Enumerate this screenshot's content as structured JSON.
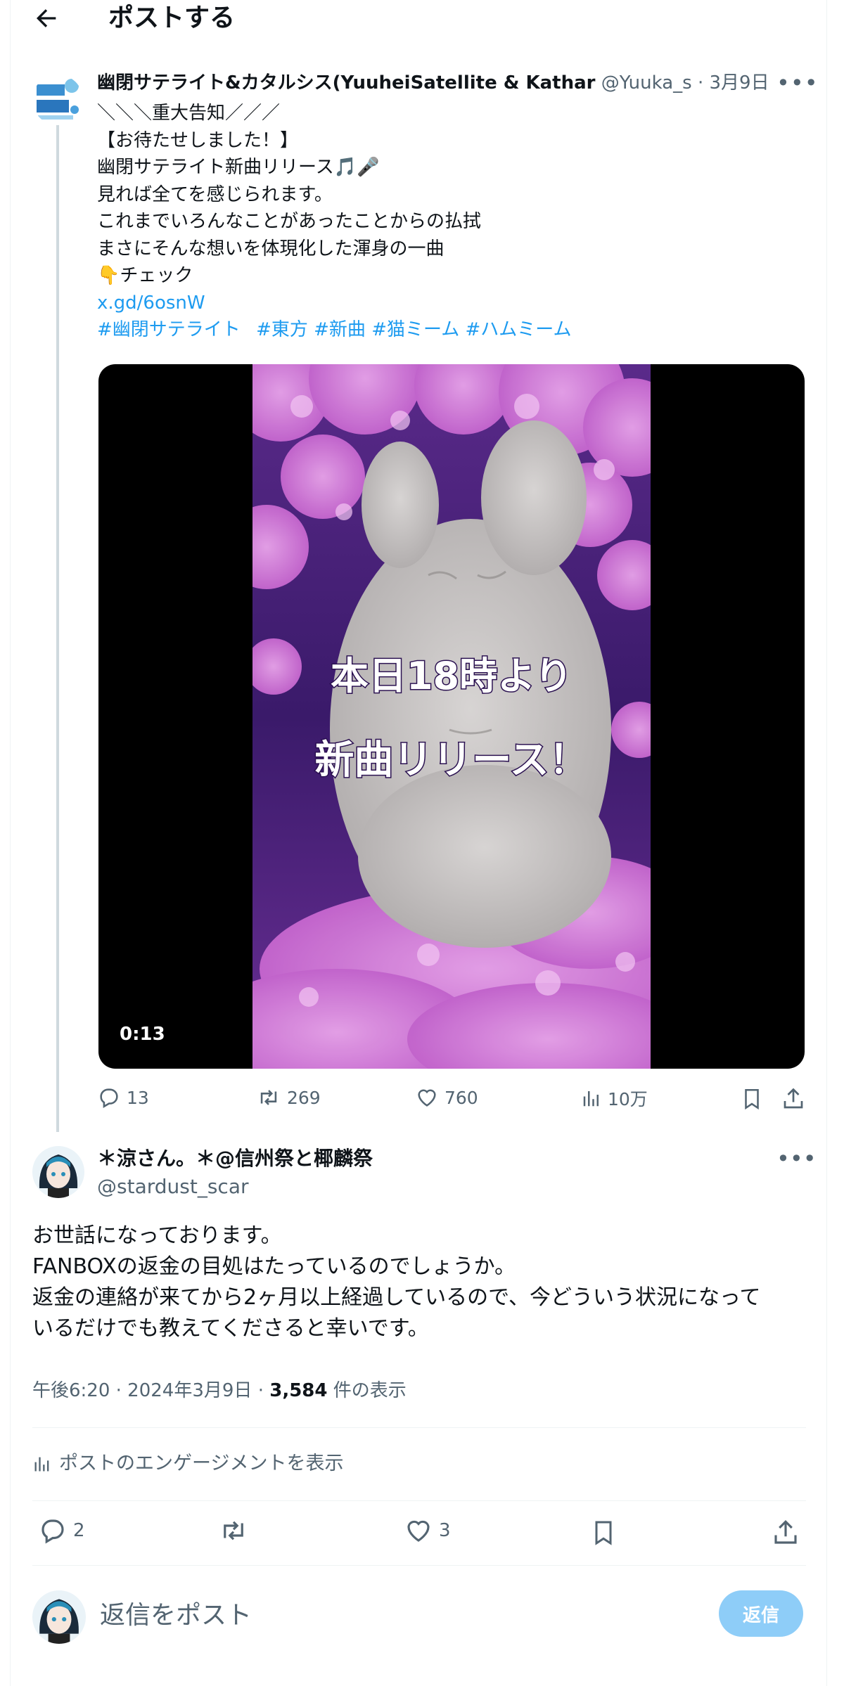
{
  "header": {
    "title": "ポストする"
  },
  "quoted_post": {
    "author_name": "幽閉サテライト&カタルシス(YuuheiSatellite & Kathar",
    "author_handle": "@Yuuka_s",
    "date": "· 3月9日",
    "lines": [
      "＼＼＼重大告知／／／",
      "【お待たせしました！】",
      "幽閉サテライト新曲リリース🎵🎤",
      "見れば全てを感じられます。",
      "これまでいろんなことがあったことからの払拭",
      "まさにそんな想いを体現化した渾身の一曲",
      "👇チェック"
    ],
    "link": "x.gd/6osnW",
    "hashtags": [
      "#幽閉サテライト",
      "#東方",
      "#新曲",
      "#猫ミーム",
      "#ハムミーム"
    ],
    "video": {
      "caption_line1": "本日18時より",
      "caption_line2": "新曲リリース！",
      "duration": "0:13"
    },
    "stats": {
      "replies": "13",
      "reposts": "269",
      "likes": "760",
      "views": "10万"
    }
  },
  "reply_post": {
    "author_name": "＊涼さん。＊@信州祭と椰麟祭",
    "author_handle": "@stardust_scar",
    "lines": [
      "お世話になっております。",
      "FANBOXの返金の目処はたっているのでしょうか。",
      "返金の連絡が来てから2ヶ月以上経過しているので、今どういう状況になって",
      "いるだけでも教えてくださると幸いです。"
    ],
    "time": "午後6:20 · 2024年3月9日 · ",
    "views_count": "3,584",
    "views_label": " 件の表示",
    "engagement_label": "ポストのエンゲージメントを表示",
    "stats": {
      "replies": "2",
      "likes": "3"
    }
  },
  "composer": {
    "placeholder": "返信をポスト",
    "button_label": "返信"
  },
  "icons": [
    "back-arrow-icon",
    "more-icon",
    "reply-icon",
    "repost-icon",
    "like-icon",
    "views-icon",
    "bookmark-icon",
    "share-icon",
    "analytics-icon"
  ],
  "colors": {
    "link": "#1d9bf0",
    "muted": "#536471",
    "reply_button": "#8ecdf8",
    "petal_pink": "#e58fe0",
    "night_purple": "#4a1f7a"
  }
}
